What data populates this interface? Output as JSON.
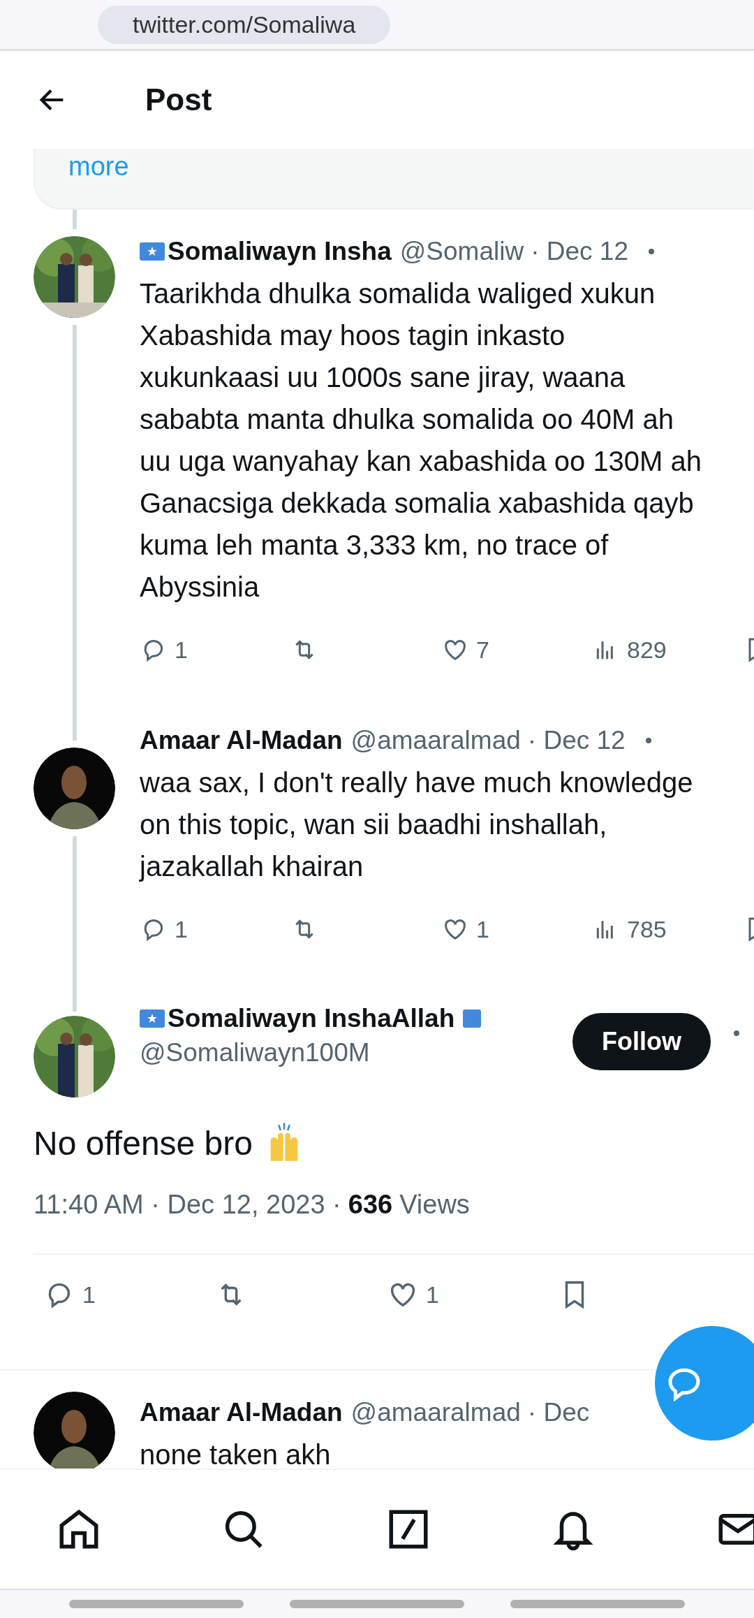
{
  "browser": {
    "url": "twitter.com/Somaliwa"
  },
  "header": {
    "title": "Post"
  },
  "quoted_card": {
    "link": "more"
  },
  "replies": [
    {
      "name": "Somaliwayn Insha",
      "flag": true,
      "handle": "@Somaliw",
      "date": "· Dec 12",
      "text": "Taarikhda dhulka somalida waliged xukun\nXabashida may hoos tagin inkasto\nxukunkaasi uu 1000s sane jiray, waana\nsababta manta dhulka somalida oo 40M ah\nuu uga wanyahay kan xabashida oo 130M ah\nGanacsiga dekkada somalia xabashida qayb\nkuma leh manta 3,333 km, no trace of\nAbyssinia",
      "replies": "1",
      "likes": "7",
      "views": "829"
    },
    {
      "name": "Amaar Al-Madan",
      "flag": false,
      "handle": "@amaaralmad",
      "date": "· Dec 12",
      "text": "waa sax, I don't really have much knowledge\non this topic, wan sii baadhi inshallah,\njazakallah khairan",
      "replies": "1",
      "likes": "1",
      "views": "785"
    }
  ],
  "main_post": {
    "name": "Somaliwayn InshaAllah",
    "flag": true,
    "verified": true,
    "handle": "@Somaliwayn100M",
    "follow": "Follow",
    "text": "No offense bro",
    "time": "11:40 AM · Dec 12, 2023 ·",
    "views_count": "636",
    "views_label": "Views",
    "replies": "1",
    "likes": "1"
  },
  "next_reply": {
    "name": "Amaar Al-Madan",
    "handle": "@amaaralmad",
    "date": "· Dec",
    "text": "none taken akh"
  }
}
